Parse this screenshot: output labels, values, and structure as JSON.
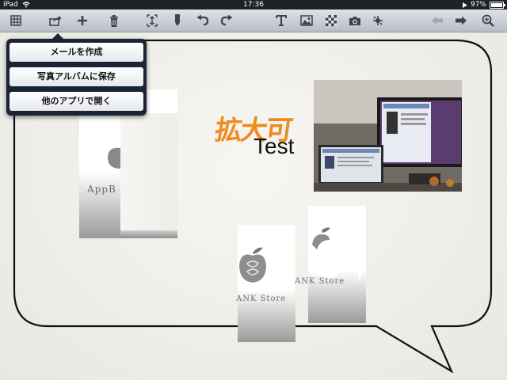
{
  "status_bar": {
    "carrier": "iPad",
    "time": "17:36",
    "battery": "97%",
    "battery_level": 0.97
  },
  "toolbar": {
    "icons": [
      "grid-icon",
      "share-icon",
      "add-icon",
      "trash-icon",
      "fit-icon",
      "marker-icon",
      "undo-icon",
      "redo-icon",
      "text-icon",
      "image-icon",
      "pattern-icon",
      "camera-icon",
      "clip-icon",
      "prev-icon",
      "next-icon",
      "zoom-icon"
    ]
  },
  "share_menu": {
    "items": [
      {
        "label": "メールを作成"
      },
      {
        "label": "写真アルバムに保存"
      },
      {
        "label": "他のアプリで開く"
      }
    ]
  },
  "canvas": {
    "handwriting": "拡大可",
    "text": "Test",
    "logo_1": "AppB",
    "logo_2": "ANK Store",
    "logo_3": "ANK Store"
  },
  "colors": {
    "accent": "#f08a1c",
    "menu_bg": "#1b2433",
    "toolbar": "#c9cdd3"
  }
}
